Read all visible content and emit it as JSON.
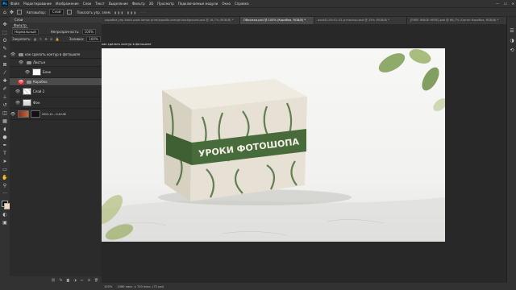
{
  "menubar": {
    "logo": "Ps",
    "items": [
      "Файл",
      "Редактирование",
      "Изображение",
      "Слои",
      "Текст",
      "Выделение",
      "Фильтр",
      "3D",
      "Просмотр",
      "Подключаемые модули",
      "Окно",
      "Справка"
    ],
    "window_controls": [
      "—",
      "☐",
      "✕"
    ]
  },
  "optbar": {
    "autoselect_label": "Автовыбор:",
    "autoselect_value": "Слой",
    "show_controls_label": "Показать упр. элем."
  },
  "tabs": [
    {
      "label": "коробка упр black pads lamps print(коробк-orange background.psd @ 16,7% (RGB/8) *",
      "active": false
    },
    {
      "label": "Обложка.psd @ 100% (Коробка, RGB/8) *",
      "active": true
    },
    {
      "label": "ozs442-09-01-02-p-mockup.psd @ 25% (RGB/8) *",
      "active": false
    },
    {
      "label": "[FREE IMAGE HERE].psb @ 66,7% (Орган Коробка, RGB/8) *",
      "active": false
    }
  ],
  "panel": {
    "title": "Слои",
    "tab_label": "Фильтр",
    "row1": {
      "blend": "Нормальный",
      "opacity_label": "Непрозрачность:",
      "opacity": "100%"
    },
    "row2": {
      "lock_label": "Закрепить:",
      "fill_label": "Заливка:",
      "fill": "100%"
    },
    "layers": [
      {
        "name": "как сделать контур в фотошопе",
        "type": "group"
      },
      {
        "name": "Листья",
        "type": "group"
      },
      {
        "name": "Блик",
        "type": "layer"
      },
      {
        "name": "Коробка",
        "type": "group",
        "selected": true
      },
      {
        "name": "Слой 2",
        "type": "layer"
      },
      {
        "name": "Фон",
        "type": "layer"
      },
      {
        "name": "2022-12-...0.40.06",
        "type": "layer"
      }
    ]
  },
  "canvas": {
    "doc_title": "как сделать контур в фотошопе",
    "box_text": "УРОКИ ФОТОШОПА",
    "box_color": "#e6e1d4",
    "band_color": "#476b3a"
  },
  "status": {
    "zoom": "100%",
    "size": "1080 пикс. x 720 пикс. (72 ppi)"
  }
}
